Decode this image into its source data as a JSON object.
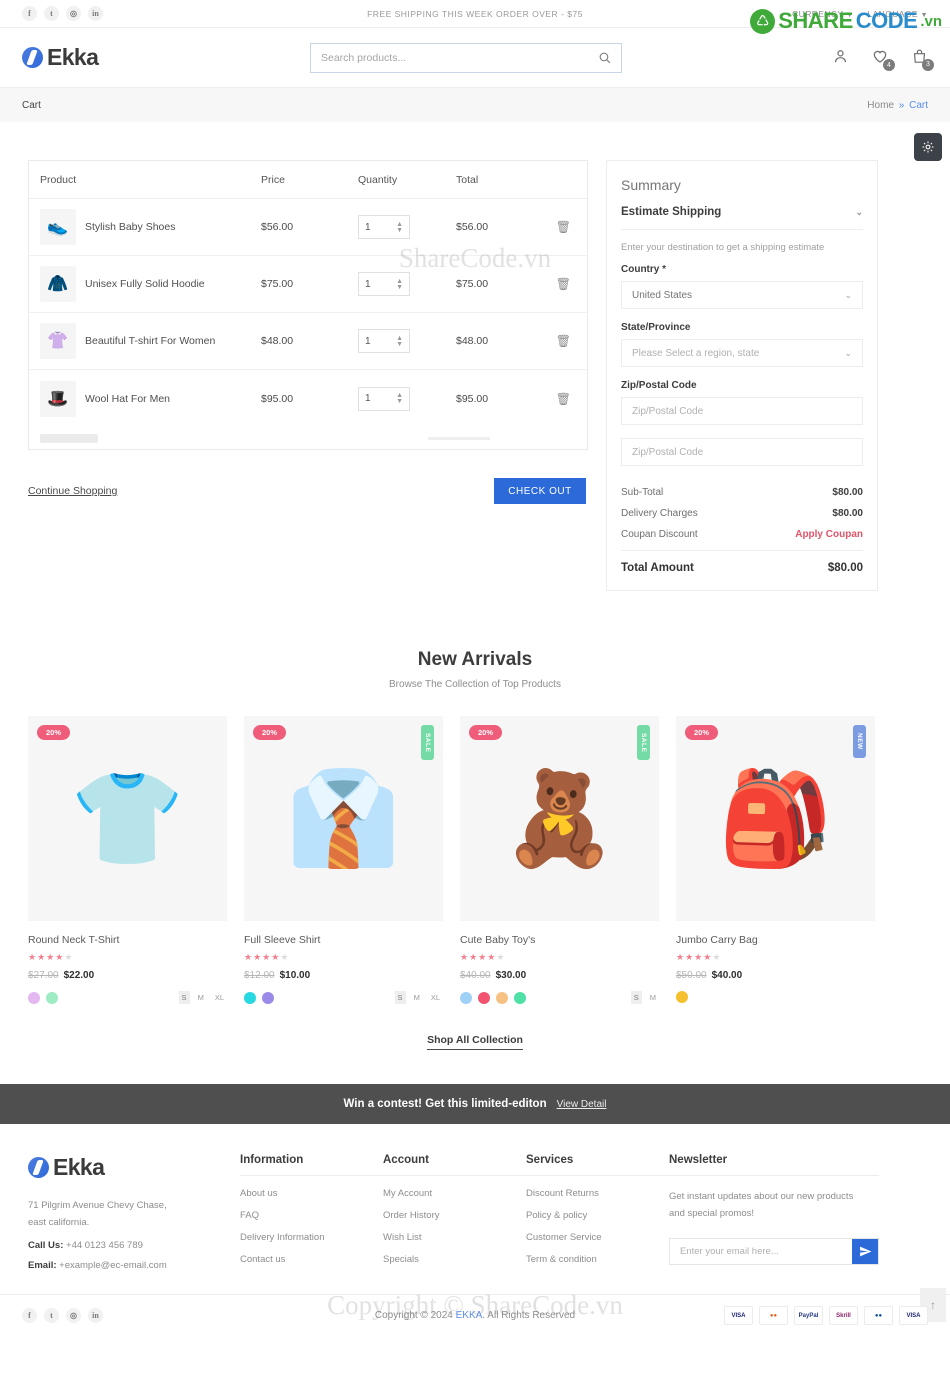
{
  "topbar": {
    "social": [
      {
        "name": "facebook-icon",
        "glyph": "f"
      },
      {
        "name": "twitter-icon",
        "glyph": "t"
      },
      {
        "name": "instagram-icon",
        "glyph": "◎"
      },
      {
        "name": "linkedin-icon",
        "glyph": "in"
      }
    ],
    "message": "FREE SHIPPING THIS WEEK ORDER OVER - $75",
    "currency_label": "CURRENCY",
    "language_label": "LANGUAGE"
  },
  "watermark": {
    "circle": "♺",
    "share": "SHARE",
    "code": "CODE",
    "vn": ".vn",
    "center_text": "Copyright © ShareCode.vn",
    "cart_text": "ShareCode.vn"
  },
  "header": {
    "brand": "Ekka",
    "search_placeholder": "Search products...",
    "search_value": "",
    "wishlist_count": "4",
    "cart_count": "3"
  },
  "breadcrumb": {
    "title": "Cart",
    "home": "Home",
    "separator": "»",
    "current": "Cart"
  },
  "cart": {
    "columns": [
      "Product",
      "Price",
      "Quantity",
      "Total",
      ""
    ],
    "rows": [
      {
        "thumb": "👟",
        "name": "Stylish Baby Shoes",
        "price": "$56.00",
        "qty": "1",
        "total": "$56.00"
      },
      {
        "thumb": "🧥",
        "name": "Unisex Fully Solid Hoodie",
        "price": "$75.00",
        "qty": "1",
        "total": "$75.00"
      },
      {
        "thumb": "👚",
        "name": "Beautiful T-shirt For Women",
        "price": "$48.00",
        "qty": "1",
        "total": "$48.00"
      },
      {
        "thumb": "🎩",
        "name": "Wool Hat For Men",
        "price": "$95.00",
        "qty": "1",
        "total": "$95.00"
      }
    ],
    "continue_shopping": "Continue Shopping",
    "checkout": "CHECK OUT"
  },
  "summary": {
    "title": "Summary",
    "estimate_shipping": "Estimate Shipping",
    "hint": "Enter your destination to get a shipping estimate",
    "country_label": "Country *",
    "country_value": "United States",
    "state_label": "State/Province",
    "state_value": "Please Select a region, state",
    "zip_label": "Zip/Postal Code",
    "zip_placeholder_1": "Zip/Postal Code",
    "zip_placeholder_2": "Zip/Postal Code",
    "zip_value_1": "",
    "zip_value_2": "",
    "lines": [
      {
        "label": "Sub-Total",
        "value": "$80.00",
        "accent": false
      },
      {
        "label": "Delivery Charges",
        "value": "$80.00",
        "accent": false
      },
      {
        "label": "Coupan Discount",
        "value": "Apply Coupan",
        "accent": true
      }
    ],
    "total_label": "Total Amount",
    "total_value": "$80.00"
  },
  "new_arrivals": {
    "title": "New Arrivals",
    "subtitle": "Browse The Collection of Top Products",
    "shop_all": "Shop All Collection",
    "products": [
      {
        "glyph": "👕",
        "discount": "20%",
        "side_tag": "",
        "side_type": "",
        "name": "Round Neck T-Shirt",
        "stars": 4,
        "old_price": "$27.00",
        "new_price": "$22.00",
        "colors": [
          "#e3b7f0",
          "#9eecc4"
        ],
        "sizes": [
          "S",
          "M",
          "XL"
        ],
        "active_size": "S"
      },
      {
        "glyph": "👔",
        "discount": "20%",
        "side_tag": "SALE",
        "side_type": "sale",
        "name": "Full Sleeve Shirt",
        "stars": 4,
        "old_price": "$12.00",
        "new_price": "$10.00",
        "colors": [
          "#27d8e0",
          "#9b8ae8"
        ],
        "sizes": [
          "S",
          "M",
          "XL"
        ],
        "active_size": "S"
      },
      {
        "glyph": "🧸",
        "discount": "20%",
        "side_tag": "SALE",
        "side_type": "sale",
        "name": "Cute Baby Toy's",
        "stars": 4,
        "old_price": "$40.00",
        "new_price": "$30.00",
        "colors": [
          "#9fd0f5",
          "#f2546f",
          "#f6c183",
          "#4fe0a8"
        ],
        "sizes": [
          "S",
          "M"
        ],
        "active_size": "S"
      },
      {
        "glyph": "🎒",
        "discount": "20%",
        "side_tag": "NEW",
        "side_type": "new",
        "name": "Jumbo Carry Bag",
        "stars": 4,
        "old_price": "$50.00",
        "new_price": "$40.00",
        "colors": [
          "#f5c02e"
        ],
        "sizes": [],
        "active_size": ""
      }
    ]
  },
  "contest": {
    "text": "Win a contest! Get this limited-editon",
    "link": "View Detail"
  },
  "footer": {
    "brand": "Ekka",
    "address_line_1": "71 Pilgrim Avenue Chevy Chase,",
    "address_line_2": "east california.",
    "call_label": "Call Us:",
    "call_value": "+44 0123 456 789",
    "email_label": "Email:",
    "email_value": "+example@ec-email.com",
    "columns": [
      {
        "heading": "Information",
        "links": [
          "About us",
          "FAQ",
          "Delivery Information",
          "Contact us"
        ]
      },
      {
        "heading": "Account",
        "links": [
          "My Account",
          "Order History",
          "Wish List",
          "Specials"
        ]
      },
      {
        "heading": "Services",
        "links": [
          "Discount Returns",
          "Policy & policy",
          "Customer Service",
          "Term & condition"
        ]
      }
    ],
    "newsletter": {
      "heading": "Newsletter",
      "text_line_1": "Get instant updates about our new products",
      "text_line_2": "and special promos!",
      "placeholder": "Enter your email here...",
      "value": ""
    }
  },
  "bottom": {
    "copyright_prefix": "Copyright © 2024",
    "brand": "EKKA",
    "copyright_suffix": ". All Rights Reserved",
    "payments": [
      "VISA",
      "MC",
      "PayPal",
      "Skrill",
      "Maestro",
      "VISA Electron"
    ],
    "social": [
      {
        "name": "facebook-icon",
        "glyph": "f"
      },
      {
        "name": "twitter-icon",
        "glyph": "t"
      },
      {
        "name": "instagram-icon",
        "glyph": "◎"
      },
      {
        "name": "linkedin-icon",
        "glyph": "in"
      }
    ]
  },
  "colors": {
    "accent_blue": "#2d6ad9",
    "pink": "#ef5d7a",
    "green": "#74dba6",
    "link_blue": "#5b8def"
  }
}
